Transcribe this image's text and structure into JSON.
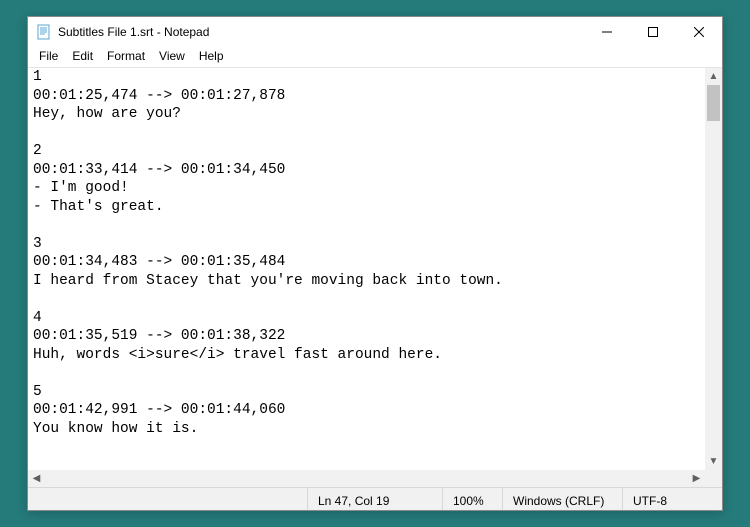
{
  "titlebar": {
    "title": "Subtitles File 1.srt - Notepad"
  },
  "menu": {
    "file": "File",
    "edit": "Edit",
    "format": "Format",
    "view": "View",
    "help": "Help"
  },
  "content": "1\n00:01:25,474 --> 00:01:27,878\nHey, how are you?\n\n2\n00:01:33,414 --> 00:01:34,450\n- I'm good!\n- That's great.\n\n3\n00:01:34,483 --> 00:01:35,484\nI heard from Stacey that you're moving back into town.\n\n4\n00:01:35,519 --> 00:01:38,322\nHuh, words <i>sure</i> travel fast around here.\n\n5\n00:01:42,991 --> 00:01:44,060\nYou know how it is.",
  "status": {
    "position": "Ln 47, Col 19",
    "zoom": "100%",
    "eol": "Windows (CRLF)",
    "encoding": "UTF-8"
  }
}
